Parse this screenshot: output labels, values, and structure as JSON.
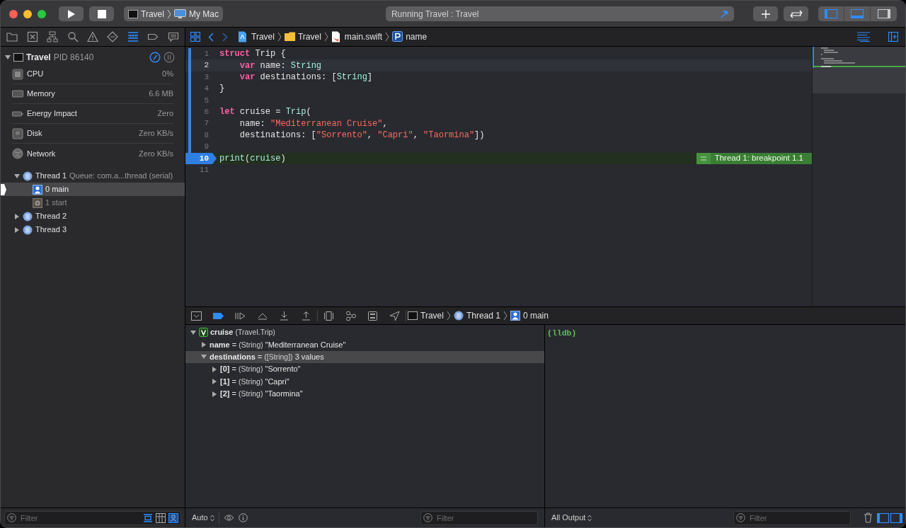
{
  "toolbar": {
    "scheme": {
      "target": "Travel",
      "device": "My Mac"
    },
    "activity": "Running Travel : Travel"
  },
  "navigator_tabs": [
    {
      "selected": false
    },
    {
      "selected": false
    },
    {
      "selected": false
    },
    {
      "selected": false
    },
    {
      "selected": false
    },
    {
      "selected": false
    },
    {
      "selected": true
    },
    {
      "selected": false
    },
    {
      "selected": false
    }
  ],
  "jump_bar": [
    {
      "kind": "project",
      "label": "Travel"
    },
    {
      "kind": "folder",
      "label": "Travel"
    },
    {
      "kind": "swift",
      "label": "main.swift"
    },
    {
      "kind": "property",
      "label": "name"
    }
  ],
  "debug_navigator": {
    "process": {
      "name": "Travel",
      "pid": "PID 86140"
    },
    "gauges": [
      {
        "kind": "cpu",
        "label": "CPU",
        "value": "0%"
      },
      {
        "kind": "memory",
        "label": "Memory",
        "value": "6.6 MB"
      },
      {
        "kind": "energy",
        "label": "Energy Impact",
        "value": "Zero"
      },
      {
        "kind": "disk",
        "label": "Disk",
        "value": "Zero KB/s"
      },
      {
        "kind": "network",
        "label": "Network",
        "value": "Zero KB/s"
      }
    ],
    "threads": [
      {
        "name": "Thread 1",
        "queue": "Queue: com.a...thread (serial)",
        "expanded": true,
        "children": [
          {
            "label": "0 main",
            "kind": "user",
            "selected": true
          },
          {
            "label": "1 start",
            "kind": "system",
            "selected": false
          }
        ]
      },
      {
        "name": "Thread 2",
        "expanded": false
      },
      {
        "name": "Thread 3",
        "expanded": false
      }
    ],
    "filter": {
      "placeholder": "Filter"
    }
  },
  "editor": {
    "lines": [
      {
        "number": "1",
        "current": false,
        "breakpoint": false,
        "tokens": [
          {
            "text": "struct",
            "kind": "keyword"
          },
          {
            "text": " Trip {",
            "kind": "plain"
          }
        ]
      },
      {
        "number": "2",
        "current": true,
        "breakpoint": false,
        "tokens": [
          {
            "text": "    var",
            "kind": "keyword"
          },
          {
            "text": " name: ",
            "kind": "plain"
          },
          {
            "text": "String",
            "kind": "type"
          }
        ]
      },
      {
        "number": "3",
        "current": false,
        "breakpoint": false,
        "tokens": [
          {
            "text": "    var",
            "kind": "keyword"
          },
          {
            "text": " destinations: [",
            "kind": "plain"
          },
          {
            "text": "String",
            "kind": "type"
          },
          {
            "text": "]",
            "kind": "plain"
          }
        ]
      },
      {
        "number": "4",
        "current": false,
        "breakpoint": false,
        "tokens": [
          {
            "text": "}",
            "kind": "plain"
          }
        ]
      },
      {
        "number": "5",
        "current": false,
        "breakpoint": false
      },
      {
        "number": "6",
        "current": false,
        "breakpoint": false,
        "tokens": [
          {
            "text": "let",
            "kind": "keyword"
          },
          {
            "text": " cruise = ",
            "kind": "plain"
          },
          {
            "text": "Trip",
            "kind": "call"
          },
          {
            "text": "(",
            "kind": "plain"
          }
        ]
      },
      {
        "number": "7",
        "current": false,
        "breakpoint": false,
        "tokens": [
          {
            "text": "    name: ",
            "kind": "plain"
          },
          {
            "text": "\"Mediterranean Cruise\"",
            "kind": "string"
          },
          {
            "text": ",",
            "kind": "plain"
          }
        ]
      },
      {
        "number": "8",
        "current": false,
        "breakpoint": false,
        "tokens": [
          {
            "text": "    destinations: [",
            "kind": "plain"
          },
          {
            "text": "\"Sorrento\"",
            "kind": "string"
          },
          {
            "text": ", ",
            "kind": "plain"
          },
          {
            "text": "\"Capri\"",
            "kind": "string"
          },
          {
            "text": ", ",
            "kind": "plain"
          },
          {
            "text": "\"Taormina\"",
            "kind": "string"
          },
          {
            "text": "])",
            "kind": "plain"
          }
        ]
      },
      {
        "number": "9",
        "current": false,
        "breakpoint": false
      },
      {
        "number": "10",
        "current": false,
        "breakpoint": true,
        "annotation": "Thread 1: breakpoint 1.1",
        "tokens": [
          {
            "text": "print",
            "kind": "call"
          },
          {
            "text": "(",
            "kind": "plain"
          },
          {
            "text": "cruise",
            "kind": "call"
          },
          {
            "text": ")",
            "kind": "plain"
          }
        ]
      },
      {
        "number": "11",
        "current": false,
        "breakpoint": false
      }
    ]
  },
  "debug_bar": {
    "path": [
      {
        "kind": "process",
        "label": "Travel"
      },
      {
        "kind": "thread",
        "label": "Thread 1"
      },
      {
        "kind": "frame",
        "label": "0 main"
      }
    ]
  },
  "variables": [
    {
      "name": "cruise",
      "type": "(Travel.Trip)",
      "expanded": true,
      "selected": false,
      "children": [
        {
          "name": "name",
          "separator": "=",
          "type": "(String)",
          "value": "\"Mediterranean Cruise\"",
          "expanded": false,
          "selected": false
        },
        {
          "name": "destinations",
          "separator": "=",
          "type": "([String])",
          "value": "3 values",
          "expanded": true,
          "selected": true,
          "children": [
            {
              "name": "[0]",
              "separator": "=",
              "type": "(String)",
              "value": "\"Sorrento\"",
              "expanded": false,
              "selected": false
            },
            {
              "name": "[1]",
              "separator": "=",
              "type": "(String)",
              "value": "\"Capri\"",
              "expanded": false,
              "selected": false
            },
            {
              "name": "[2]",
              "separator": "=",
              "type": "(String)",
              "value": "\"Taormina\"",
              "expanded": false,
              "selected": false
            }
          ]
        }
      ]
    }
  ],
  "variables_bar": {
    "scope": "Auto",
    "filter": {
      "placeholder": "Filter"
    }
  },
  "console": {
    "output": "(lldb)",
    "mode": "All Output",
    "filter": {
      "placeholder": "Filter"
    }
  }
}
